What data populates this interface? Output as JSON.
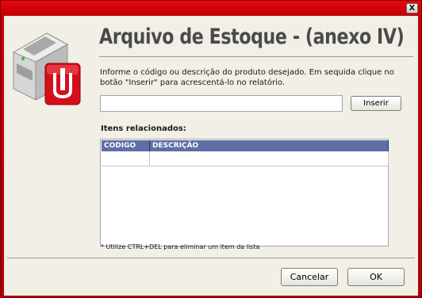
{
  "window": {
    "close_icon": "close-icon",
    "close_glyph": "X"
  },
  "header": {
    "title": "Arquivo de Estoque - (anexo IV)",
    "logo_icon": "printer-document-icon"
  },
  "form": {
    "instruction": "Informe o código ou descrição do produto desejado. Em sequida clique no botão \"Inserir\" para acrescentá-lo no relatório.",
    "search_value": "",
    "insert_label": "Inserir"
  },
  "related": {
    "label": "Itens relacionados:",
    "columns": [
      "CODIGO",
      "DESCRIÇÃO"
    ],
    "rows": [
      [
        "",
        ""
      ]
    ]
  },
  "hint": "* Utilize CTRL+DEL para eliminar um item da lista",
  "footer": {
    "cancel_label": "Cancelar",
    "ok_label": "OK"
  },
  "colors": {
    "frame": "#c00008",
    "client": "#f1efe6",
    "grid_header": "#5f6ea5",
    "logo_red": "#d40f1b"
  }
}
